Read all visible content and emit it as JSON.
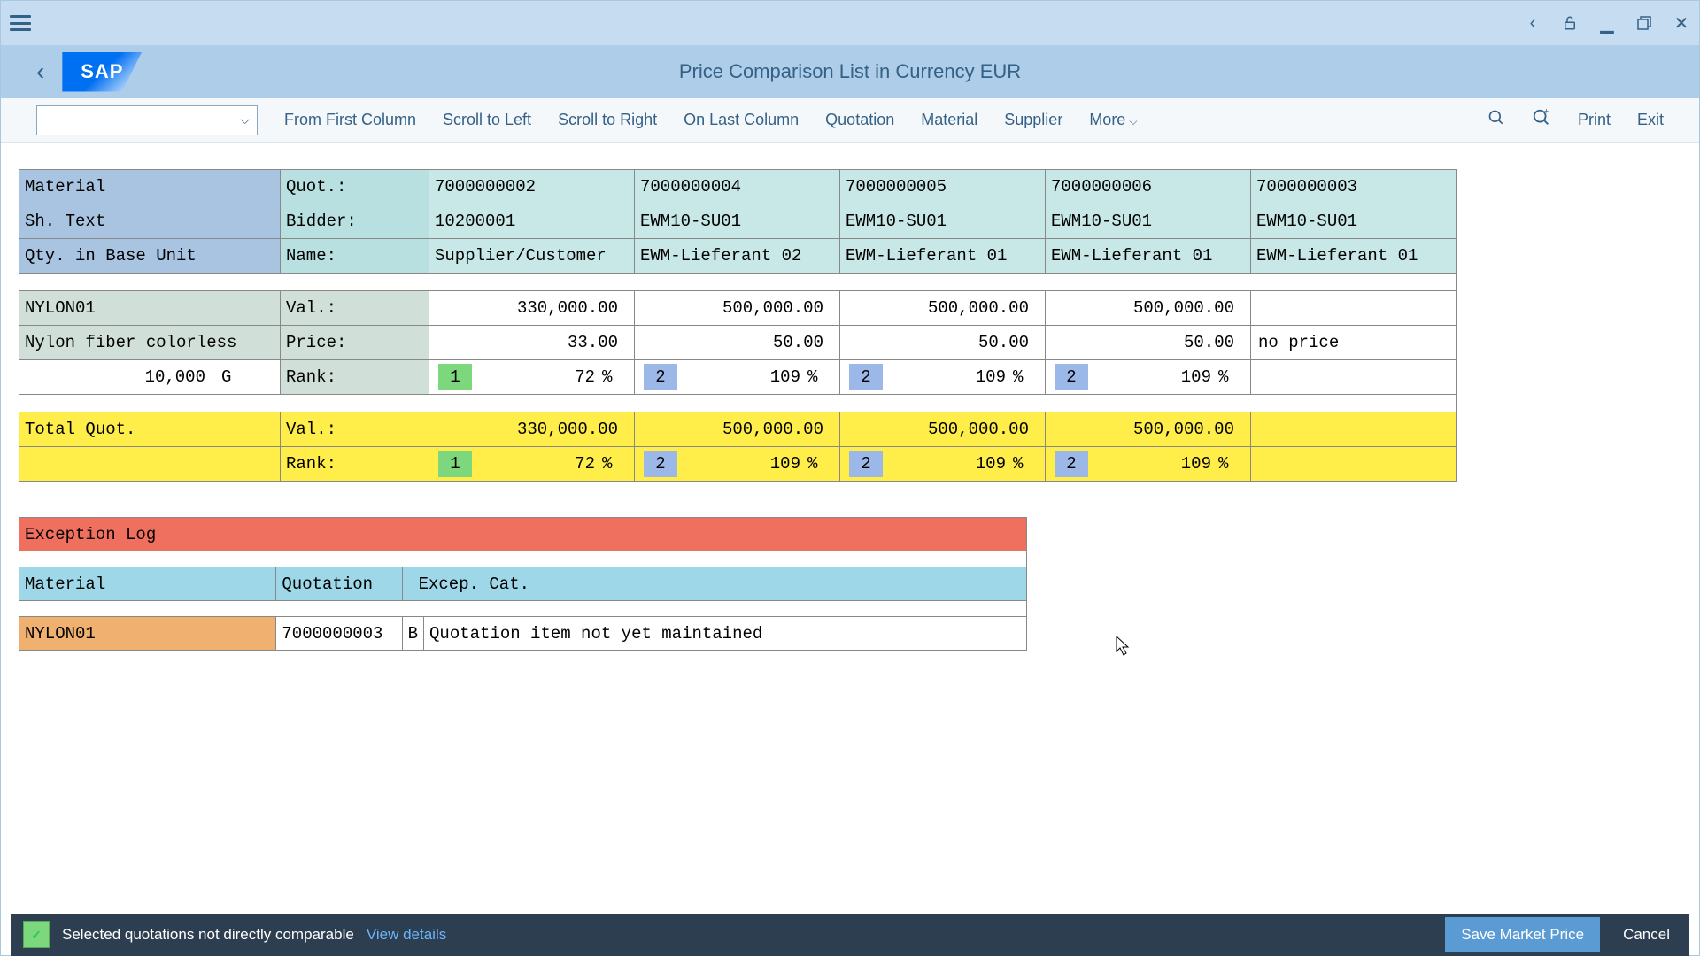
{
  "title": "Price Comparison List in Currency EUR",
  "logo_text": "SAP",
  "toolbar": {
    "from_first": "From First Column",
    "scroll_left": "Scroll to Left",
    "scroll_right": "Scroll to Right",
    "on_last": "On Last Column",
    "quotation": "Quotation",
    "material": "Material",
    "supplier": "Supplier",
    "more": "More",
    "print": "Print",
    "exit": "Exit"
  },
  "grid": {
    "headers": {
      "material": "Material",
      "shtext": "Sh. Text",
      "qtybase": "Qty. in Base Unit",
      "quot": "Quot.:",
      "bidder": "Bidder:",
      "name": "Name:"
    },
    "quotes": [
      {
        "quot": "7000000002",
        "bidder": "10200001",
        "name": "Supplier/Customer",
        "val": "330,000.00",
        "price": "33.00",
        "rank": "1",
        "pct": "72",
        "rankcls": "rank-1"
      },
      {
        "quot": "7000000004",
        "bidder": "EWM10-SU01",
        "name": "EWM-Lieferant 02",
        "val": "500,000.00",
        "price": "50.00",
        "rank": "2",
        "pct": "109",
        "rankcls": "rank-2"
      },
      {
        "quot": "7000000005",
        "bidder": "EWM10-SU01",
        "name": "EWM-Lieferant 01",
        "val": "500,000.00",
        "price": "50.00",
        "rank": "2",
        "pct": "109",
        "rankcls": "rank-2"
      },
      {
        "quot": "7000000006",
        "bidder": "EWM10-SU01",
        "name": "EWM-Lieferant 01",
        "val": "500,000.00",
        "price": "50.00",
        "rank": "2",
        "pct": "109",
        "rankcls": "rank-2"
      },
      {
        "quot": "7000000003",
        "bidder": "EWM10-SU01",
        "name": "EWM-Lieferant 01",
        "val": "",
        "price": "no price",
        "rank": "",
        "pct": "",
        "rankcls": ""
      }
    ],
    "material": {
      "id": "NYLON01",
      "desc": "Nylon fiber colorless",
      "qty": "10,000",
      "unit": "G",
      "val_label": "Val.:",
      "price_label": "Price:",
      "rank_label": "Rank:"
    },
    "total": {
      "label": "Total Quot.",
      "val_label": "Val.:",
      "rank_label": "Rank:",
      "vals": [
        "330,000.00",
        "500,000.00",
        "500,000.00",
        "500,000.00",
        ""
      ],
      "ranks": [
        {
          "rank": "1",
          "pct": "72",
          "cls": "rank-1"
        },
        {
          "rank": "2",
          "pct": "109",
          "cls": "rank-2"
        },
        {
          "rank": "2",
          "pct": "109",
          "cls": "rank-2"
        },
        {
          "rank": "2",
          "pct": "109",
          "cls": "rank-2"
        },
        {
          "rank": "",
          "pct": "",
          "cls": ""
        }
      ]
    }
  },
  "exception": {
    "title": "Exception Log",
    "h_material": "Material",
    "h_quotation": "Quotation",
    "h_excep": "Excep. Cat.",
    "row": {
      "material": "NYLON01",
      "quotation": "7000000003",
      "b": "B",
      "msg": "Quotation item not yet maintained"
    }
  },
  "footer": {
    "msg": "Selected quotations not directly comparable",
    "link": "View details",
    "save": "Save Market Price",
    "cancel": "Cancel"
  }
}
